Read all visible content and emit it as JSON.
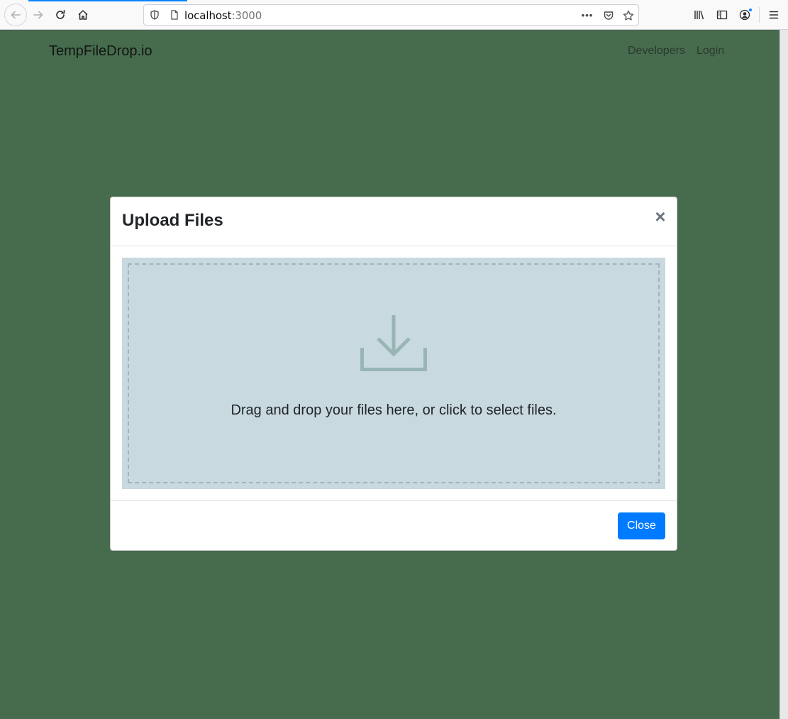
{
  "browser": {
    "url_host": "localhost",
    "url_port": ":3000",
    "icons": {
      "back": "arrow-left-icon",
      "forward": "arrow-right-icon",
      "reload": "reload-icon",
      "home": "home-icon",
      "shield": "shield-icon",
      "page": "page-icon",
      "more": "more-dots-icon",
      "pocket": "pocket-icon",
      "bookmark": "star-icon",
      "library": "library-icon",
      "sidebar": "sidebar-icon",
      "account": "account-icon",
      "menu": "hamburger-menu-icon"
    },
    "more_label": "•••"
  },
  "navbar": {
    "brand": "TempFileDrop.io",
    "links": [
      "Developers",
      "Login"
    ]
  },
  "modal": {
    "title": "Upload Files",
    "close_symbol": "×",
    "dropzone_icon": "download-icon",
    "dropzone_text": "Drag and drop your files here, or click to select files.",
    "close_button": "Close"
  },
  "colors": {
    "page_background": "#466c4d",
    "dropzone_background": "#c8d9df",
    "primary_button": "#007bff",
    "icon_tint": "#99b4b5"
  }
}
